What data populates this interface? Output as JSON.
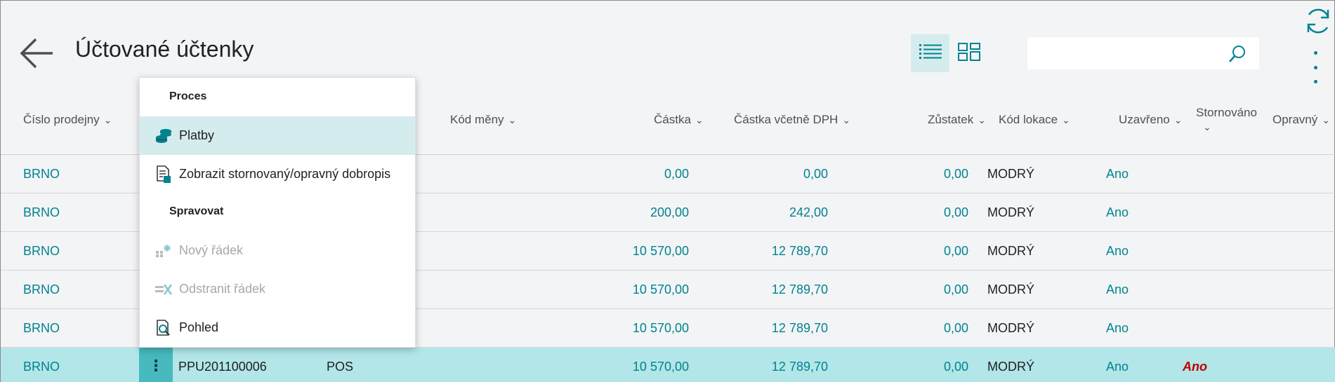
{
  "header": {
    "title": "Účtované účtenky",
    "search_placeholder": ""
  },
  "columns": {
    "store_no": "Číslo prodejny",
    "currency_code": "Kód měny",
    "amount": "Částka",
    "amount_incl_vat": "Částka včetně DPH",
    "remaining": "Zůstatek",
    "location_code": "Kód lokace",
    "closed": "Uzavřeno",
    "cancelled": "Stornováno",
    "corrective": "Opravný"
  },
  "rows": [
    {
      "store": "BRNO",
      "receipt": "",
      "currency": "",
      "amount": "0,00",
      "amount_vat": "0,00",
      "remaining": "0,00",
      "location": "MODRÝ",
      "closed": "Ano",
      "cancelled": ""
    },
    {
      "store": "BRNO",
      "receipt": "",
      "currency": "",
      "amount": "200,00",
      "amount_vat": "242,00",
      "remaining": "0,00",
      "location": "MODRÝ",
      "closed": "Ano",
      "cancelled": ""
    },
    {
      "store": "BRNO",
      "receipt": "",
      "currency": "",
      "amount": "10 570,00",
      "amount_vat": "12 789,70",
      "remaining": "0,00",
      "location": "MODRÝ",
      "closed": "Ano",
      "cancelled": ""
    },
    {
      "store": "BRNO",
      "receipt": "",
      "currency": "",
      "amount": "10 570,00",
      "amount_vat": "12 789,70",
      "remaining": "0,00",
      "location": "MODRÝ",
      "closed": "Ano",
      "cancelled": ""
    },
    {
      "store": "BRNO",
      "receipt": "",
      "currency": "",
      "amount": "10 570,00",
      "amount_vat": "12 789,70",
      "remaining": "0,00",
      "location": "MODRÝ",
      "closed": "Ano",
      "cancelled": ""
    },
    {
      "store": "BRNO",
      "receipt": "PPU201100006",
      "currency": "POS",
      "amount": "10 570,00",
      "amount_vat": "12 789,70",
      "remaining": "0,00",
      "location": "MODRÝ",
      "closed": "Ano",
      "cancelled": "Ano"
    }
  ],
  "row_menu_glyph": "⋮",
  "menu": {
    "group_process": "Proces",
    "payments": "Platby",
    "show_credit_memo": "Zobrazit stornovaný/opravný dobropis",
    "group_manage": "Spravovat",
    "new_line": "Nový řádek",
    "delete_line": "Odstranit řádek",
    "view": "Pohled"
  },
  "colors": {
    "accent": "#00838f",
    "selected_row": "#b2e6e8",
    "menu_hover": "#d5ecee",
    "cancelled_red": "#c00000"
  },
  "icons": {
    "back": "arrow-left-icon",
    "list_view": "list-view-icon",
    "tile_view": "tile-view-icon",
    "search": "search-icon",
    "refresh": "refresh-icon",
    "more": "more-vertical-icon"
  }
}
